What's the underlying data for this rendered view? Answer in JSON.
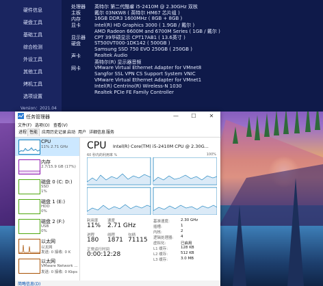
{
  "sysinfo": {
    "nav": [
      "硬件信息",
      "硬盘工具",
      "基础工具",
      "综合检测",
      "外设工具",
      "其他工具",
      "烤机工具",
      "选项设置"
    ],
    "version": "Version：2021.04",
    "rows": [
      {
        "label": "处理器",
        "value": "英特尔 第二代酷睿 i5-2410M @ 2.30GHz 双核"
      },
      {
        "label": "主板",
        "value": "戴尔 03NKW8 ( 英特尔 HM67 芯片组 )"
      },
      {
        "label": "内存",
        "value": "16GB DDR3 1600MHz ( 8GB + 8GB )"
      },
      {
        "label": "显卡",
        "value": "Intel(R) HD Graphics 3000 ( 1.9GB / 戴尔 )"
      },
      {
        "label": "",
        "value": "AMD Radeon 6600M and 6700M Series ( 1GB / 戴尔 )"
      },
      {
        "label": "显示器",
        "value": "CPT 39华硕显示 CPT17AB1 ( 13.6英寸 )"
      },
      {
        "label": "硬盘",
        "value": "ST500VT000-1DK142 ( 500GB )"
      },
      {
        "label": "",
        "value": "Samsung SSD 750 EVO 250GB ( 250GB )"
      },
      {
        "label": "声卡",
        "value": "Realtek Audio"
      },
      {
        "label": "",
        "value": "英特尔(R) 显示器音频"
      },
      {
        "label": "网卡",
        "value": "VMware Virtual Ethernet Adapter for VMnet8"
      },
      {
        "label": "",
        "value": "Sangfor SSL VPN CS Support System VNIC"
      },
      {
        "label": "",
        "value": "VMware Virtual Ethernet Adapter for VMnet1"
      },
      {
        "label": "",
        "value": "Intel(R) Centrino(R) Wireless-N 1030"
      },
      {
        "label": "",
        "value": "Realtek PCIe FE Family Controller"
      }
    ]
  },
  "taskmgr": {
    "title": "任务管理器",
    "menus": [
      "文件(F)",
      "选项(O)",
      "查看(V)"
    ],
    "tabs": [
      "进程",
      "性能",
      "应用历史记录",
      "启动",
      "用户",
      "详细信息",
      "服务"
    ],
    "active_tab": "性能",
    "list": [
      {
        "name": "CPU",
        "sub": "11% 2.71 GHz",
        "sub2": "",
        "color": "#117dbb",
        "selected": true
      },
      {
        "name": "内存",
        "sub": "2.7/15.9 GB (17%)",
        "sub2": "",
        "color": "#8b12ae",
        "selected": false
      },
      {
        "name": "磁盘 0 (C: D:)",
        "sub": "SSD",
        "sub2": "1%",
        "color": "#4da60c",
        "selected": false
      },
      {
        "name": "磁盘 1 (E:)",
        "sub": "HDD",
        "sub2": "0%",
        "color": "#4da60c",
        "selected": false
      },
      {
        "name": "磁盘 2 (F:)",
        "sub": "USB",
        "sub2": "0%",
        "color": "#4da60c",
        "selected": false
      },
      {
        "name": "以太网",
        "sub": "以太网",
        "sub2": "发送: 0 接收: 0 K",
        "color": "#a74f01",
        "selected": false
      },
      {
        "name": "以太网",
        "sub": "VMware Network ...",
        "sub2": "发送: 0 接收: 0 Kbps",
        "color": "#a74f01",
        "selected": false
      }
    ],
    "detail": {
      "title": "CPU",
      "model": "Intel(R) Core(TM) i5-2410M CPU @ 2.30G...",
      "graph_caption_left": "60 秒内的利用率 %",
      "graph_caption_right": "100%",
      "stats": {
        "util_label": "利用率",
        "util_value": "11%",
        "speed_label": "速度",
        "speed_value": "2.71 GHz",
        "proc_label": "进程",
        "proc_value": "180",
        "threads_label": "线程",
        "threads_value": "1871",
        "handles_label": "句柄",
        "handles_value": "71115",
        "uptime_label": "正常运行时间",
        "uptime_value": "0:00:12:28"
      },
      "specs": [
        {
          "k": "基准速度:",
          "v": "2.30 GHz"
        },
        {
          "k": "插槽:",
          "v": "1"
        },
        {
          "k": "内核:",
          "v": "2"
        },
        {
          "k": "逻辑处理器:",
          "v": "4"
        },
        {
          "k": "虚拟化:",
          "v": "已启用"
        },
        {
          "k": "L1 缓存:",
          "v": "128 KB"
        },
        {
          "k": "L2 缓存:",
          "v": "512 KB"
        },
        {
          "k": "L3 缓存:",
          "v": "3.0 MB"
        }
      ]
    },
    "footer": "简略信息(D)"
  }
}
